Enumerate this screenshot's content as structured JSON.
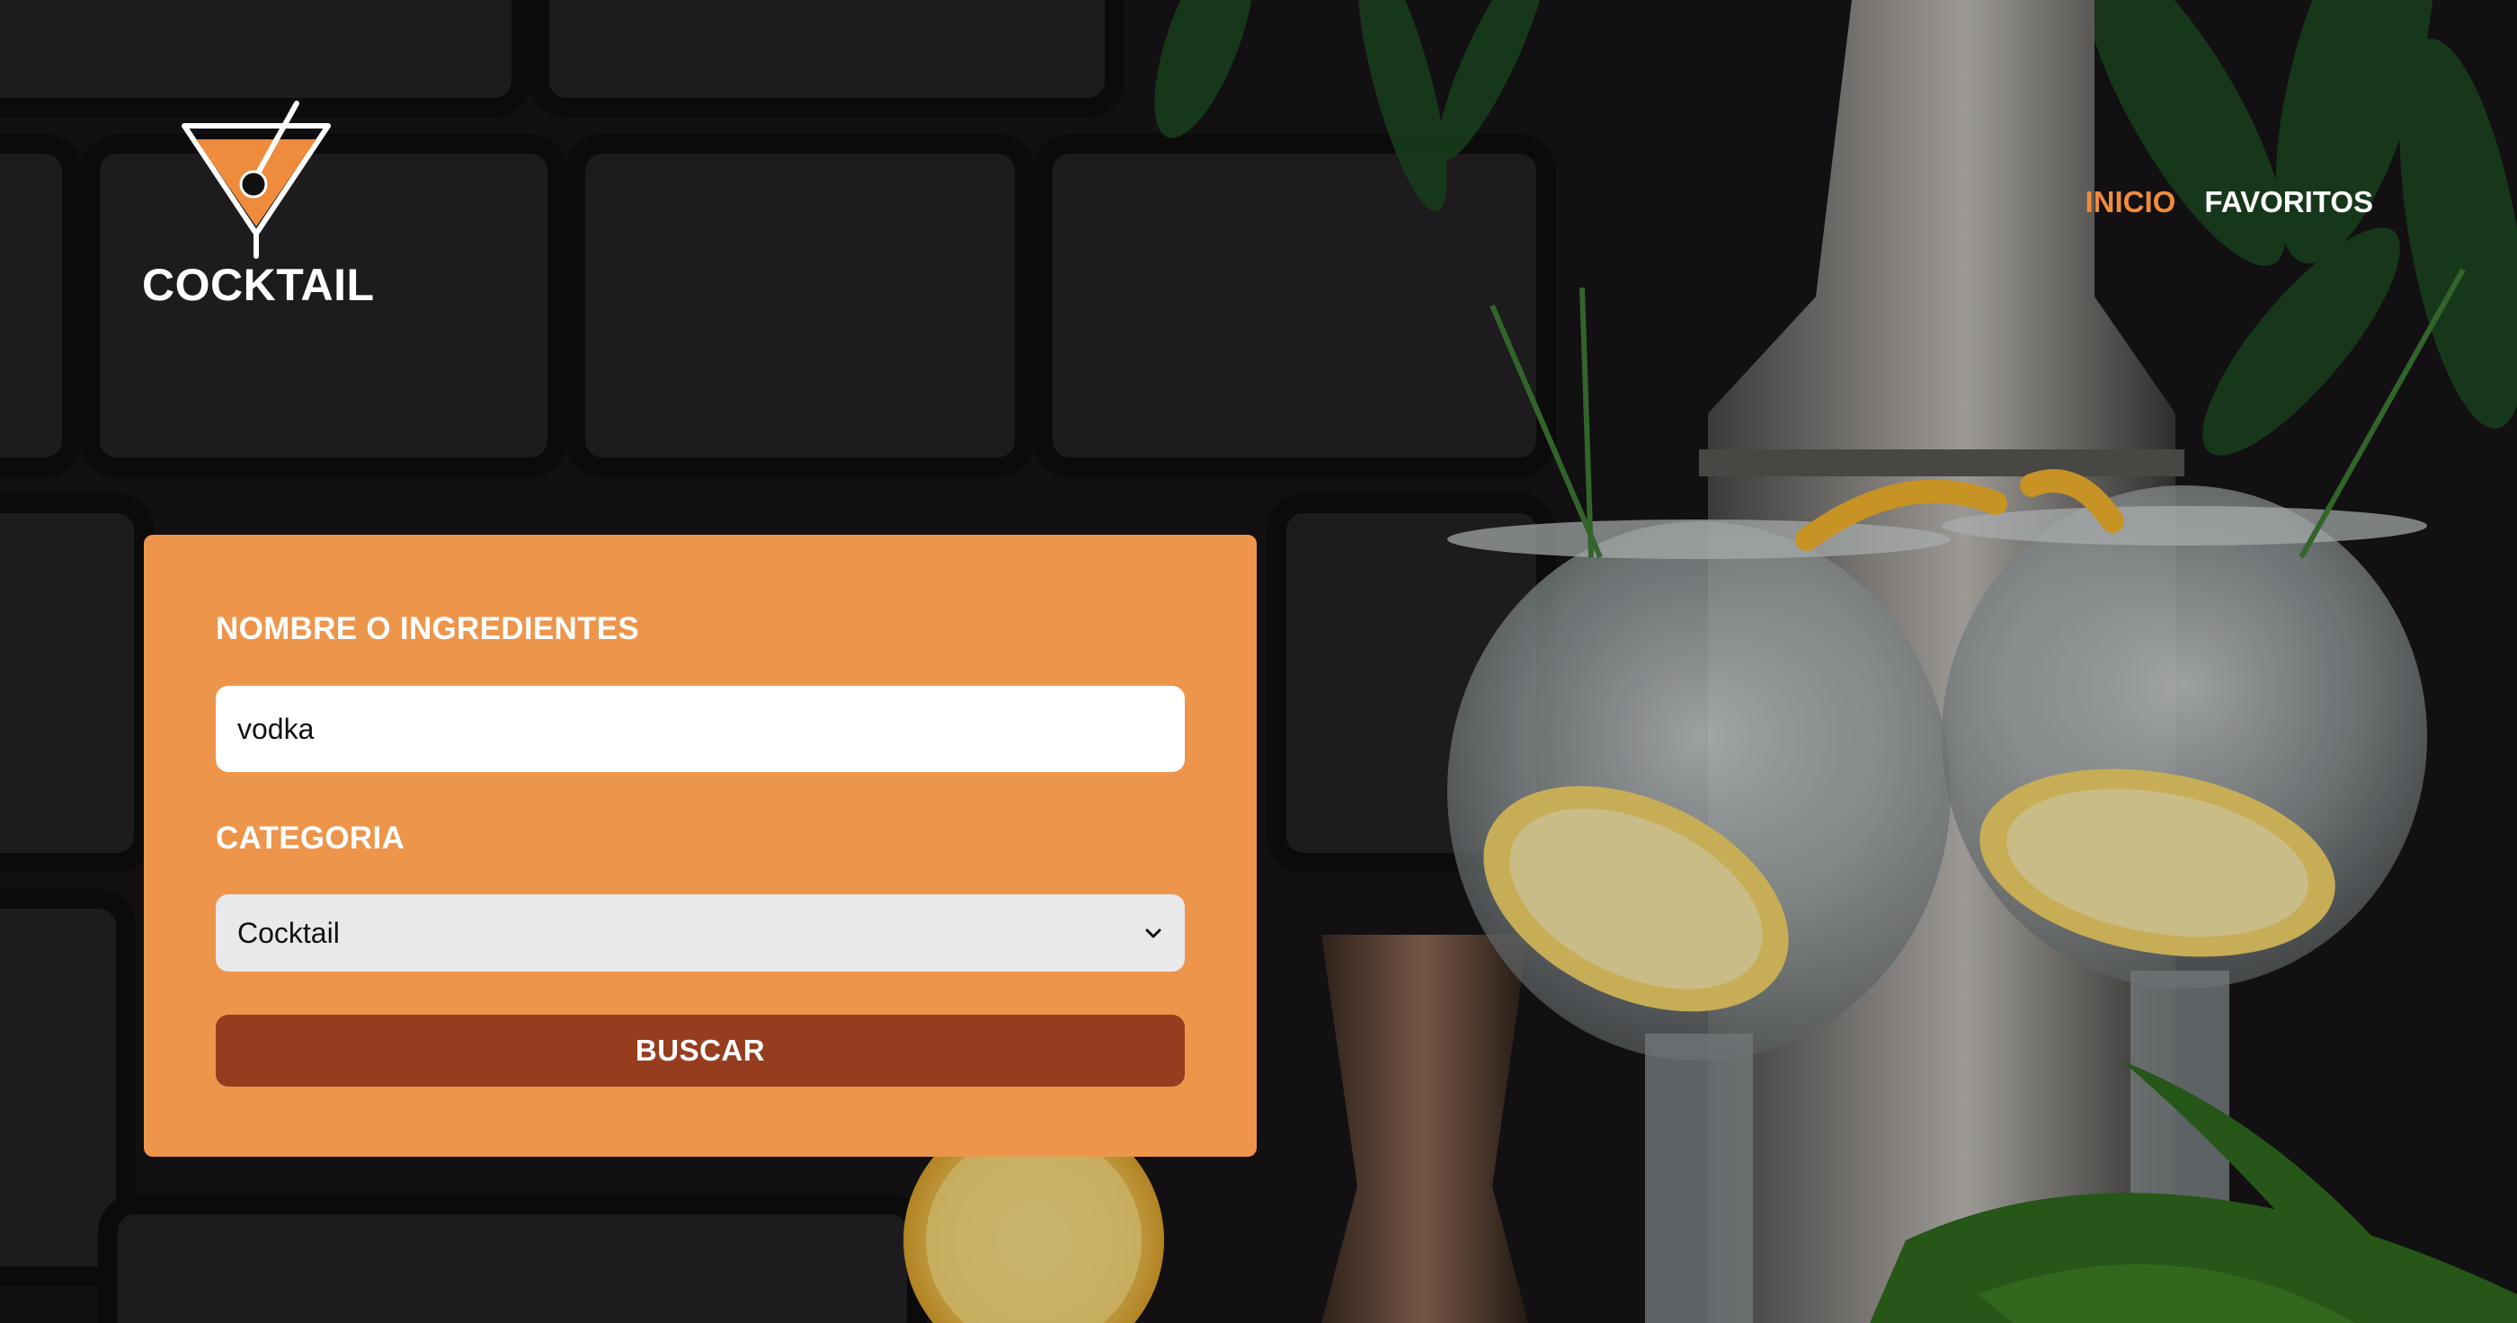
{
  "header": {
    "logo_text": "COCKTAIL",
    "logo_icon": "martini-glass-icon"
  },
  "nav": {
    "items": [
      {
        "label": "INICIO",
        "active": true
      },
      {
        "label": "FAVORITOS",
        "active": false
      }
    ]
  },
  "search_form": {
    "name_label": "NOMBRE O INGREDIENTES",
    "name_value": "vodka",
    "category_label": "CATEGORIA",
    "category_selected": "Cocktail",
    "submit_label": "BUSCAR"
  },
  "colors": {
    "accent": "#ef8b3c",
    "card_background": "#ee954c",
    "button_background": "#963c1f",
    "select_background": "#e9e9ec"
  }
}
